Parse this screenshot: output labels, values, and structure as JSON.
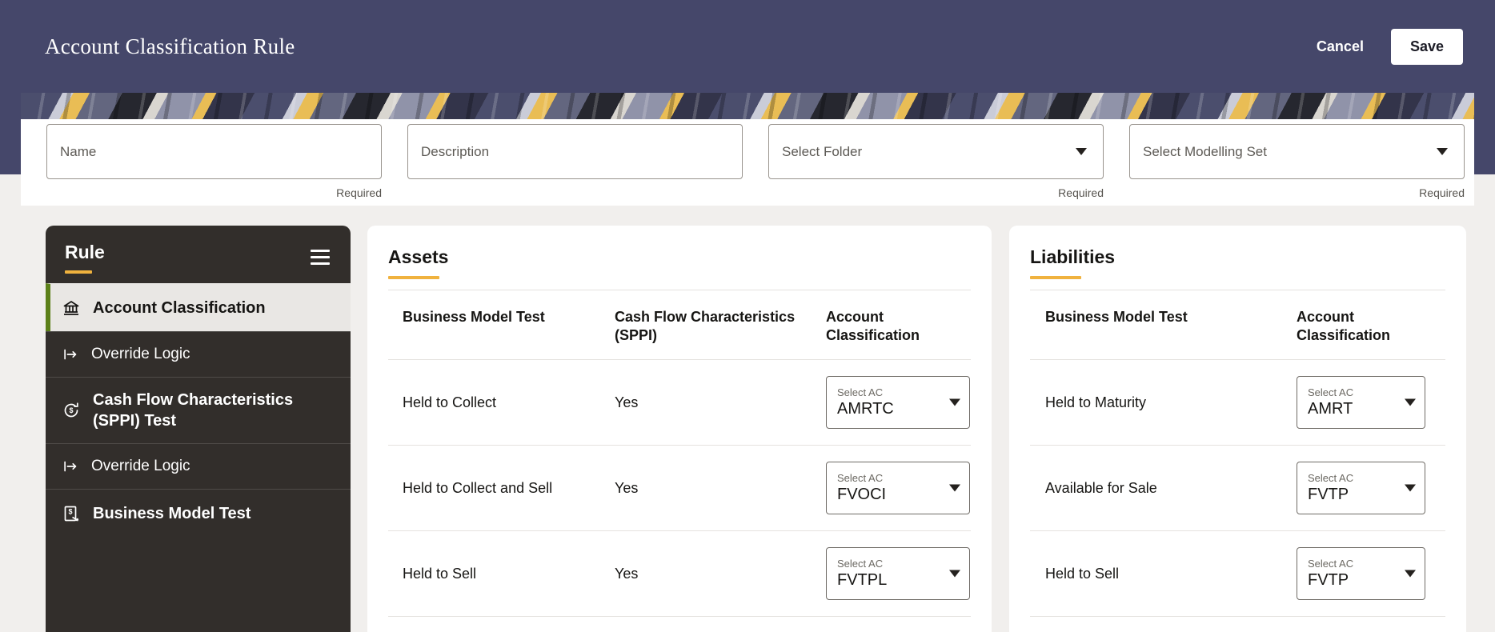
{
  "header": {
    "title": "Account Classification Rule",
    "cancel_label": "Cancel",
    "save_label": "Save"
  },
  "form": {
    "name": {
      "placeholder": "Name",
      "required": "Required"
    },
    "description": {
      "placeholder": "Description"
    },
    "folder": {
      "label": "Select Folder",
      "required": "Required"
    },
    "modelling_set": {
      "label": "Select Modelling Set",
      "required": "Required"
    }
  },
  "sidebar": {
    "title": "Rule",
    "items": [
      {
        "label": "Account Classification",
        "icon": "bank-icon",
        "selected": true
      },
      {
        "label": "Override Logic",
        "icon": "map-arrow-icon",
        "selected": false
      },
      {
        "label": "Cash Flow Characteristics (SPPI) Test",
        "icon": "cycle-dollar-icon",
        "selected": false
      },
      {
        "label": "Override Logic",
        "icon": "map-arrow-icon",
        "selected": false
      },
      {
        "label": "Business Model Test",
        "icon": "document-dollar-icon",
        "selected": false
      }
    ]
  },
  "assets": {
    "title": "Assets",
    "columns": [
      "Business Model Test",
      "Cash Flow Characteristics (SPPI)",
      "Account Classification"
    ],
    "ac_label": "Select AC",
    "rows": [
      {
        "business_model": "Held to Collect",
        "sppi": "Yes",
        "value": "AMRTC"
      },
      {
        "business_model": "Held to Collect and Sell",
        "sppi": "Yes",
        "value": "FVOCI"
      },
      {
        "business_model": "Held to Sell",
        "sppi": "Yes",
        "value": "FVTPL"
      }
    ]
  },
  "liabilities": {
    "title": "Liabilities",
    "columns": [
      "Business Model Test",
      "Account Classification"
    ],
    "ac_label": "Select AC",
    "rows": [
      {
        "business_model": "Held to Maturity",
        "value": "AMRT"
      },
      {
        "business_model": "Available for Sale",
        "value": "FVTP"
      },
      {
        "business_model": "Held to Sell",
        "value": "FVTP"
      }
    ]
  },
  "colors": {
    "header_bg": "#45476a",
    "accent_gold": "#f0b23e",
    "selected_green": "#5c8019",
    "sidebar_bg": "#322e2b"
  }
}
